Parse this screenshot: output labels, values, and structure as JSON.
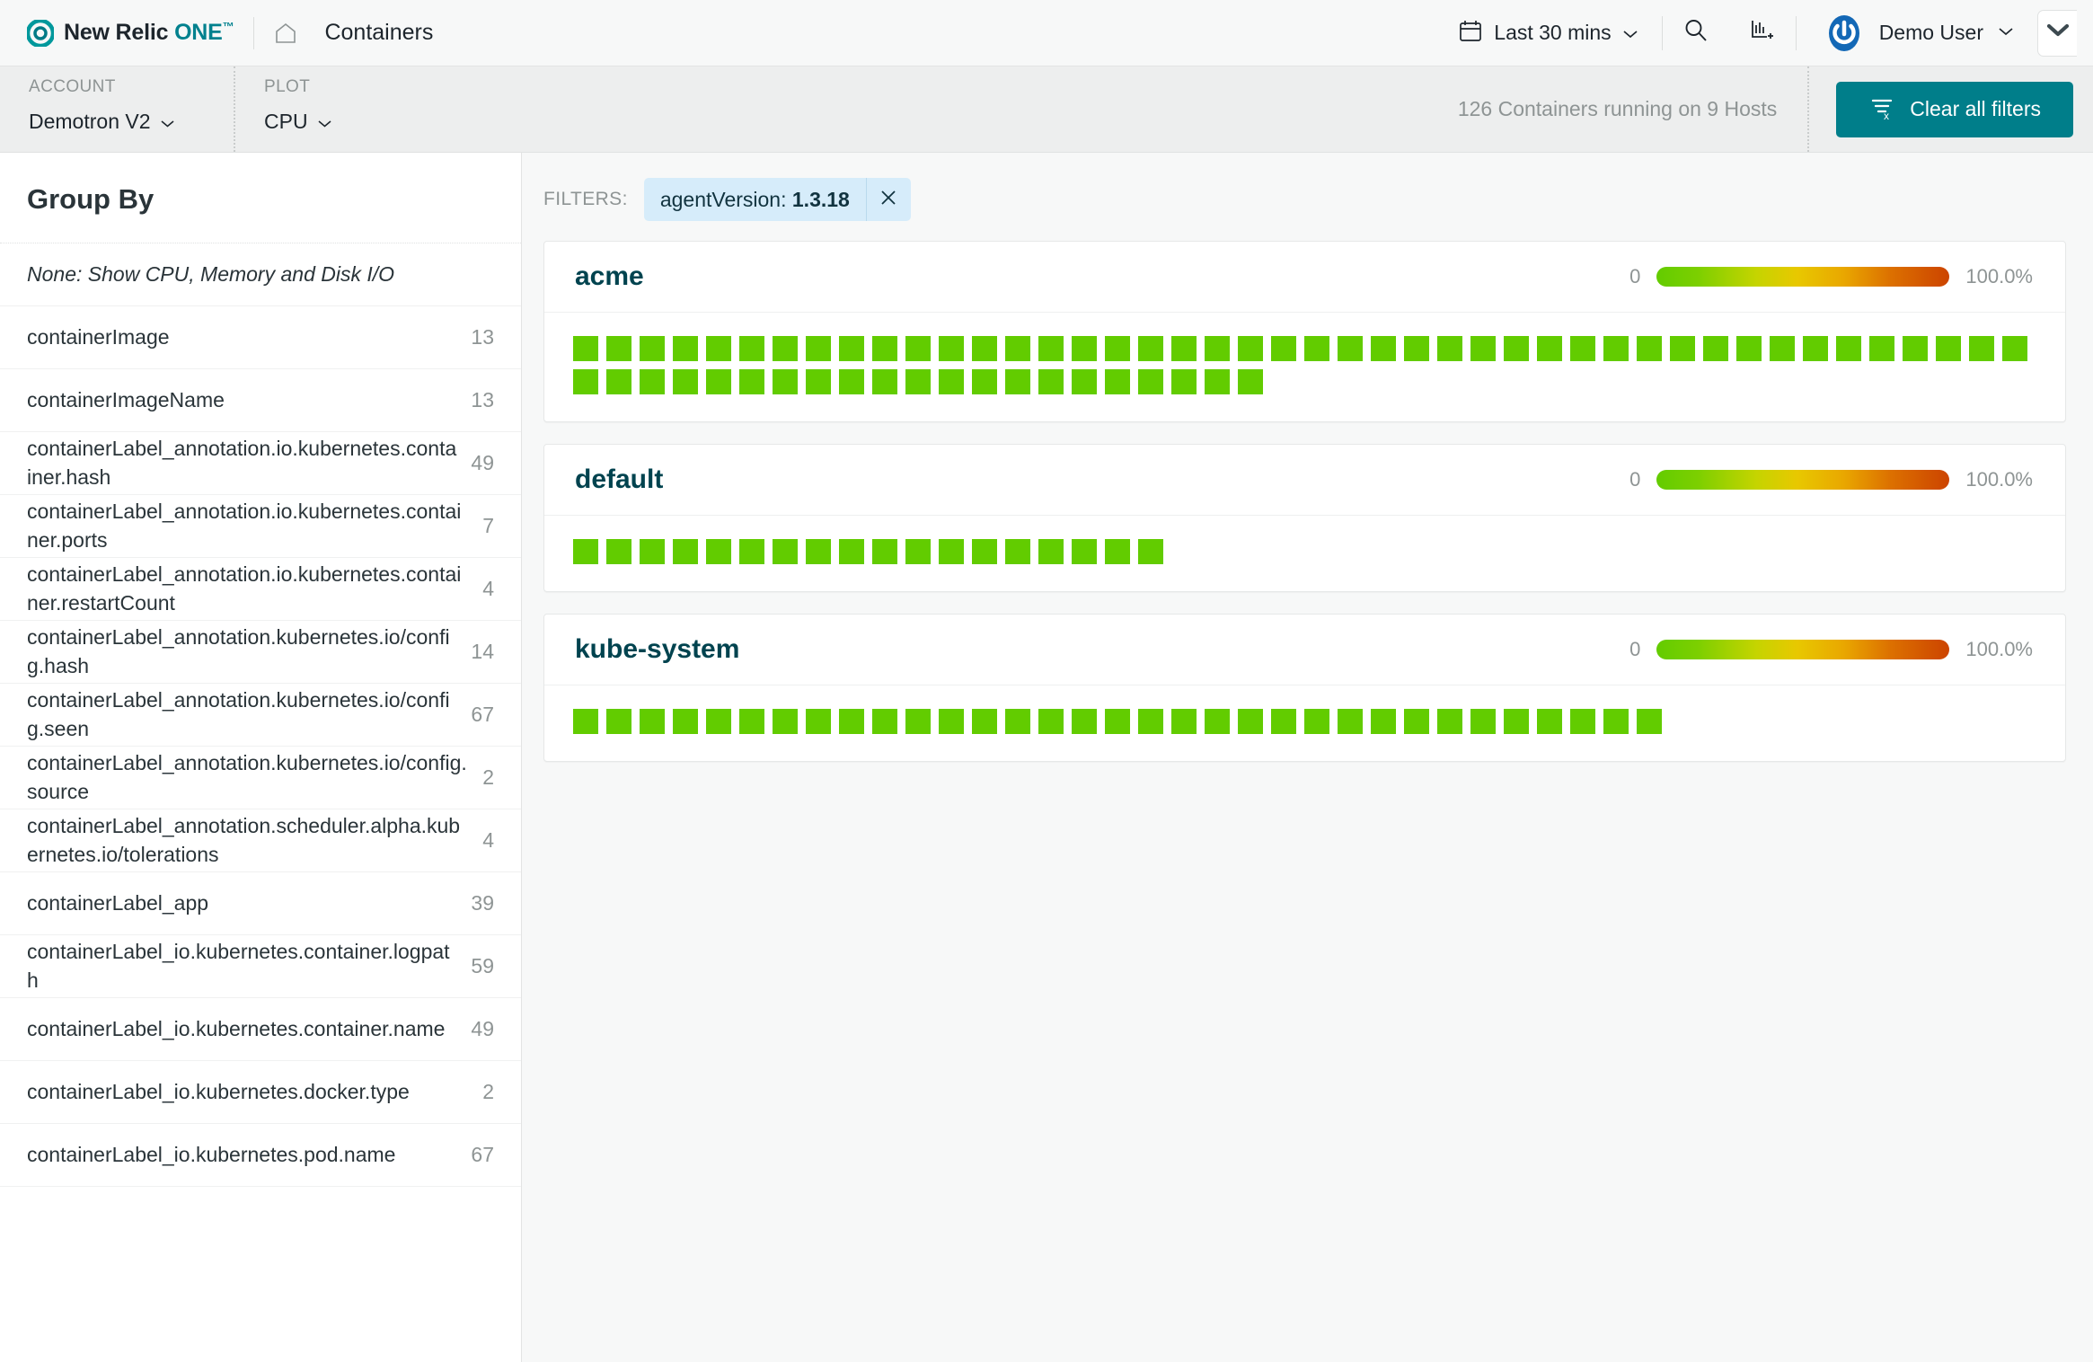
{
  "header": {
    "brand_new": "New Relic",
    "brand_one": "ONE",
    "brand_tm": "™",
    "home_icon": "home-icon",
    "page_title": "Containers",
    "time_range": "Last 30 mins",
    "time_chevron": "⌄",
    "calendar_icon": "calendar-icon",
    "search_icon": "search-icon",
    "add_chart_icon": "add-to-dashboard-icon",
    "user_name": "Demo User",
    "user_chevron": "⌄",
    "avatar_icon": "user-avatar-icon",
    "collapse_chevron": "⌄"
  },
  "toolbar": {
    "account_label": "ACCOUNT",
    "account_value": "Demotron V2",
    "account_chevron": "⌄",
    "plot_label": "PLOT",
    "plot_value": "CPU",
    "plot_chevron": "⌄",
    "running_summary": "126 Containers running on 9 Hosts",
    "clear_filters_label": "Clear all filters",
    "clear_filters_icon": "filter-clear-icon",
    "accent_color": "#007e8a"
  },
  "sidebar": {
    "title": "Group By",
    "items": [
      {
        "label": "None: Show CPU, Memory and Disk I/O",
        "count": "",
        "italic": true
      },
      {
        "label": "containerImage",
        "count": "13"
      },
      {
        "label": "containerImageName",
        "count": "13"
      },
      {
        "label": "containerLabel_annotation.io.kubernetes.container.hash",
        "count": "49"
      },
      {
        "label": "containerLabel_annotation.io.kubernetes.container.ports",
        "count": "7"
      },
      {
        "label": "containerLabel_annotation.io.kubernetes.container.restartCount",
        "count": "4"
      },
      {
        "label": "containerLabel_annotation.kubernetes.io/config.hash",
        "count": "14"
      },
      {
        "label": "containerLabel_annotation.kubernetes.io/config.seen",
        "count": "67"
      },
      {
        "label": "containerLabel_annotation.kubernetes.io/config.source",
        "count": "2"
      },
      {
        "label": "containerLabel_annotation.scheduler.alpha.kubernetes.io/tolerations",
        "count": "4"
      },
      {
        "label": "containerLabel_app",
        "count": "39"
      },
      {
        "label": "containerLabel_io.kubernetes.container.logpath",
        "count": "59"
      },
      {
        "label": "containerLabel_io.kubernetes.container.name",
        "count": "49"
      },
      {
        "label": "containerLabel_io.kubernetes.docker.type",
        "count": "2"
      },
      {
        "label": "containerLabel_io.kubernetes.pod.name",
        "count": "67"
      }
    ]
  },
  "filters": {
    "label": "FILTERS:",
    "chips": [
      {
        "key": "agentVersion: ",
        "value": "1.3.18",
        "remove_icon": "close-icon"
      }
    ]
  },
  "chart_data": {
    "type": "heatmap",
    "title": "Containers grouped by namespace, colored by CPU %",
    "legend_min": "0",
    "legend_max": "100.0%",
    "legend_position": "card-header-right",
    "color_scale": [
      "#63cc00",
      "#c5d400",
      "#e8c800",
      "#dc7000",
      "#cc4400"
    ],
    "value_unit": "%",
    "groups": [
      {
        "name": "acme",
        "container_count": 65,
        "cell_color": "#62cc00",
        "legend_min": "0",
        "legend_max": "100.0%"
      },
      {
        "name": "default",
        "container_count": 18,
        "cell_color": "#62cc00",
        "legend_min": "0",
        "legend_max": "100.0%"
      },
      {
        "name": "kube-system",
        "container_count": 33,
        "cell_color": "#62cc00",
        "legend_min": "0",
        "legend_max": "100.0%"
      }
    ]
  }
}
